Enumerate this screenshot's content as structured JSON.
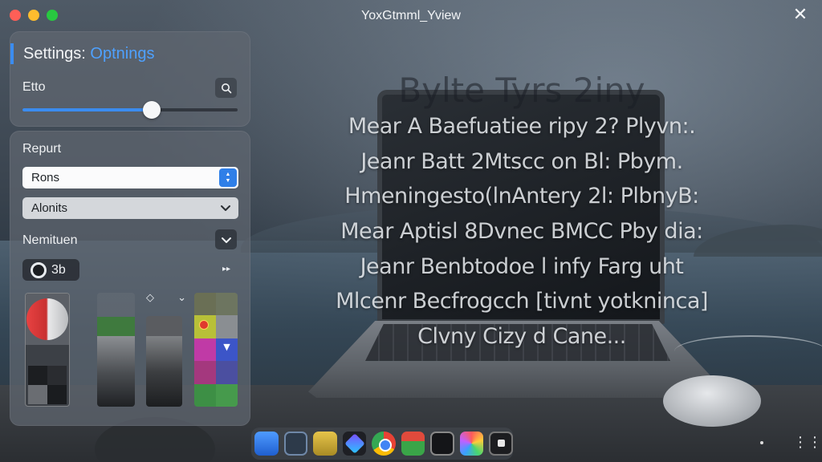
{
  "window": {
    "title": "YoxGtmml_Yview",
    "close_icon": "close-icon"
  },
  "panel_top": {
    "heading_prefix": "Settings:",
    "heading_accent": "Optnings",
    "label": "Etto",
    "slider": {
      "value": 0.6
    },
    "accent_color": "#3b8cf0"
  },
  "panel_bottom": {
    "label_repurt": "Repurt",
    "input_value": "Rons",
    "select_value": "Alonits",
    "label_nemituen": "Nemituen",
    "toggle_label": "3b"
  },
  "overlay": {
    "title": "Bylte Tyrs 2iny",
    "lines": [
      "Mear A Baefuatiee ripy 2? Plyvn:.",
      "Jeanr Batt 2Mtscc on Bl: Pbym.",
      "Hmeningesto(lnAntery 2l: PlbnyB:",
      "Mear Aptisl 8Dvnec BMCC Pby dia:",
      "Jeanr Benbtodoe l infy Farg uht",
      "Mlcenr Becfrogcch [tivnt yotkninca]",
      "Clvny Cizy d Cane..."
    ]
  },
  "dock": {
    "icons": [
      "finder-icon",
      "settings-icon",
      "notes-icon",
      "app-icon",
      "chrome-icon",
      "calendar-icon",
      "terminal-icon",
      "photos-icon",
      "screenshot-icon"
    ]
  }
}
